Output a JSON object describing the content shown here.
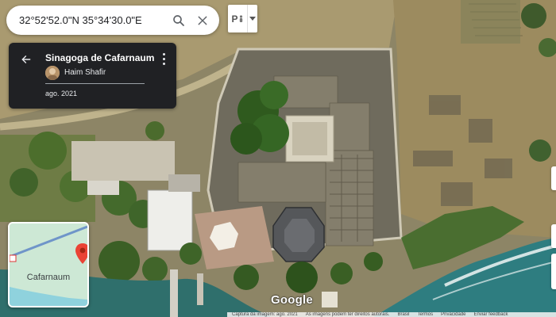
{
  "search": {
    "value": "32°52'52.0\"N 35°34'30.0\"E",
    "search_icon": "search-icon",
    "close_icon": "close-icon"
  },
  "streetview": {
    "pegman_label": "P",
    "pegman_icon": "pegman-icon",
    "dropdown_icon": "caret-down-icon"
  },
  "card": {
    "title": "Sinagoga de Cafarnaum",
    "author": "Haim Shafir",
    "date": "ago. 2021",
    "back_icon": "arrow-back-icon",
    "menu_icon": "more-vert-icon"
  },
  "minimap": {
    "label": "Cafarnaum",
    "pin_icon": "map-pin-icon"
  },
  "brand": {
    "logo": "Google"
  },
  "footer": {
    "items": [
      "Captura da imagem: ago. 2021",
      "As imagens podem ter direitos autorais.",
      "Brasil",
      "Termos",
      "Privacidade",
      "Enviar feedback"
    ]
  },
  "colors": {
    "card_bg": "#202124",
    "pin": "#ea4335",
    "water": "#2f6f6c"
  }
}
